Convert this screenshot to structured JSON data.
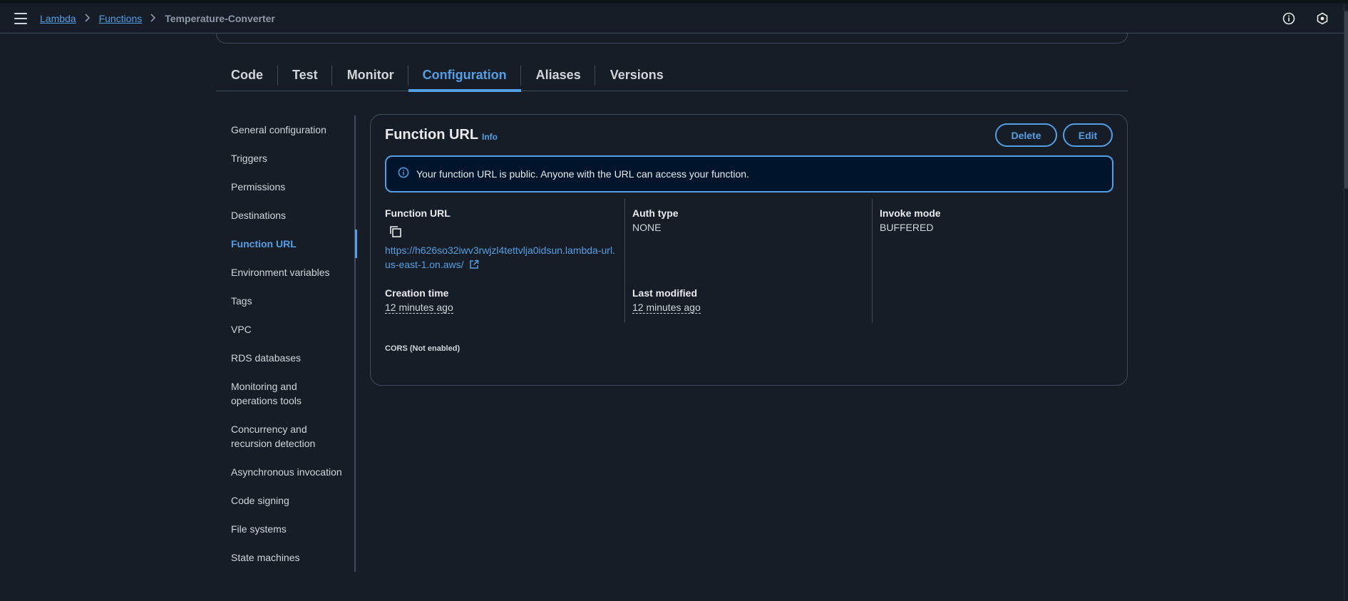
{
  "breadcrumb": {
    "items": [
      "Lambda",
      "Functions"
    ],
    "current": "Temperature-Converter"
  },
  "icons": {
    "menu": "hamburger-menu-icon",
    "info": "info-circle-icon",
    "settings": "hexagon-settings-icon",
    "copy": "copy-icon",
    "external": "external-link-icon"
  },
  "tabs": [
    {
      "label": "Code"
    },
    {
      "label": "Test"
    },
    {
      "label": "Monitor"
    },
    {
      "label": "Configuration",
      "active": true
    },
    {
      "label": "Aliases"
    },
    {
      "label": "Versions"
    }
  ],
  "sidenav": {
    "items": [
      {
        "label": "General configuration"
      },
      {
        "label": "Triggers"
      },
      {
        "label": "Permissions"
      },
      {
        "label": "Destinations"
      },
      {
        "label": "Function URL",
        "active": true
      },
      {
        "label": "Environment variables"
      },
      {
        "label": "Tags"
      },
      {
        "label": "VPC"
      },
      {
        "label": "RDS databases"
      },
      {
        "label": "Monitoring and operations tools"
      },
      {
        "label": "Concurrency and recursion detection"
      },
      {
        "label": "Asynchronous invocation"
      },
      {
        "label": "Code signing"
      },
      {
        "label": "File systems"
      },
      {
        "label": "State machines"
      }
    ]
  },
  "panel": {
    "title": "Function URL",
    "info_label": "Info",
    "delete_label": "Delete",
    "edit_label": "Edit",
    "alert_text": "Your function URL is public. Anyone with the URL can access your function.",
    "function_url_label": "Function URL",
    "function_url_value": "https://h626so32iwv3rwjzl4tettvlja0idsun.lambda-url.us-east-1.on.aws/",
    "auth_type_label": "Auth type",
    "auth_type_value": "NONE",
    "invoke_mode_label": "Invoke mode",
    "invoke_mode_value": "BUFFERED",
    "creation_time_label": "Creation time",
    "creation_time_value": "12 minutes ago",
    "last_modified_label": "Last modified",
    "last_modified_value": "12 minutes ago",
    "cors_label": "CORS (Not enabled)"
  },
  "colors": {
    "background": "#161d26",
    "accent": "#539fe5",
    "border": "#414d5c",
    "alert_bg": "#00142b"
  }
}
